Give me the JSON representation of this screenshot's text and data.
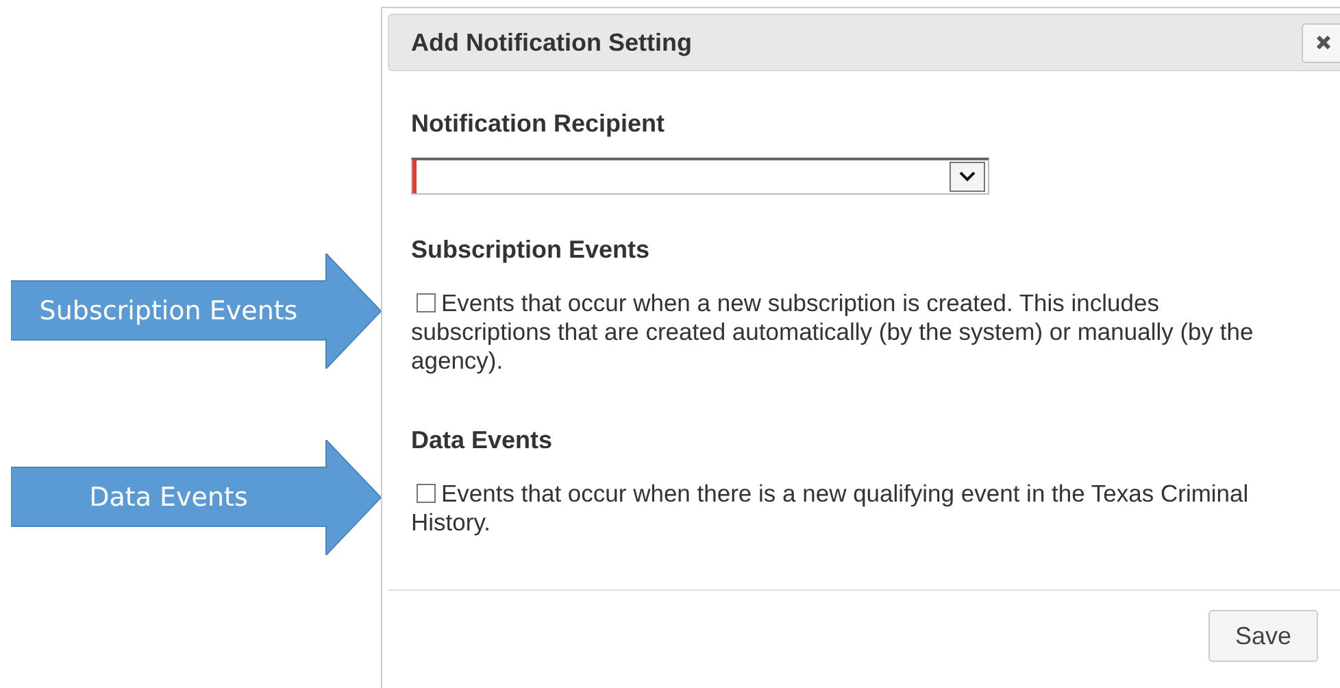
{
  "annotations": [
    {
      "label": "Subscription Events"
    },
    {
      "label": "Data Events"
    }
  ],
  "dialog": {
    "title": "Add Notification Setting",
    "recipient": {
      "label": "Notification Recipient",
      "invalid": true
    },
    "sections": [
      {
        "heading": "Subscription Events",
        "checked": false,
        "text": "Events that occur when a new subscription is created. This includes subscriptions that are created automatically (by the system) or manually (by the agency)."
      },
      {
        "heading": "Data Events",
        "checked": false,
        "text": "Events that occur when there is a new qualifying event in the Texas Criminal History."
      }
    ],
    "buttons": [
      "Save"
    ]
  }
}
